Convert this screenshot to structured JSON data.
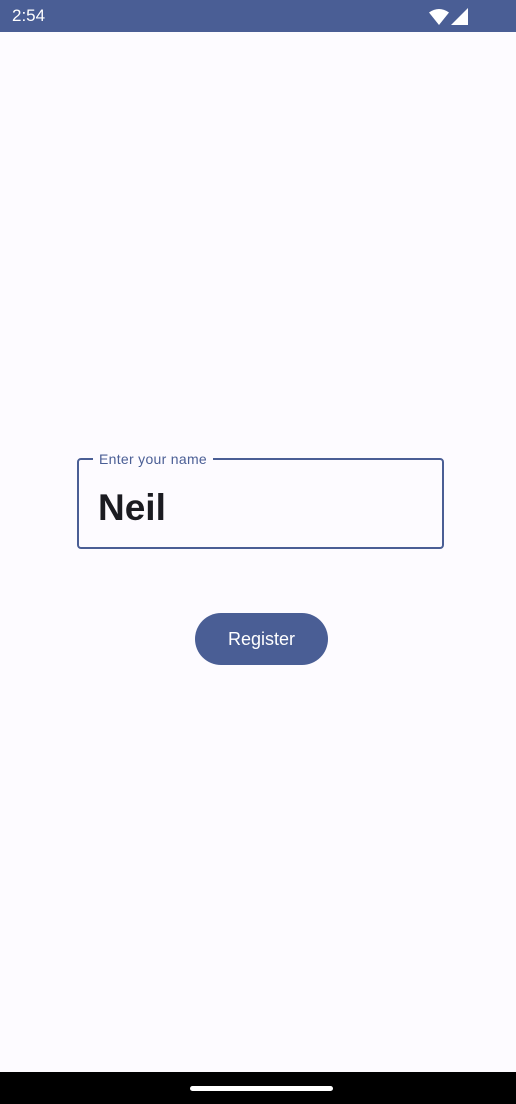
{
  "status_bar": {
    "time": "2:54",
    "icons": [
      "wifi-icon",
      "cell-signal-icon"
    ],
    "background": "#4a5e95"
  },
  "form": {
    "name_field": {
      "label": "Enter your name",
      "value": "Neil"
    },
    "register_label": "Register"
  },
  "colors": {
    "accent": "#4a5e95",
    "background": "#fdfbff",
    "text": "#1b1b21"
  },
  "navigation_bar": {
    "handle": "home-handle"
  }
}
